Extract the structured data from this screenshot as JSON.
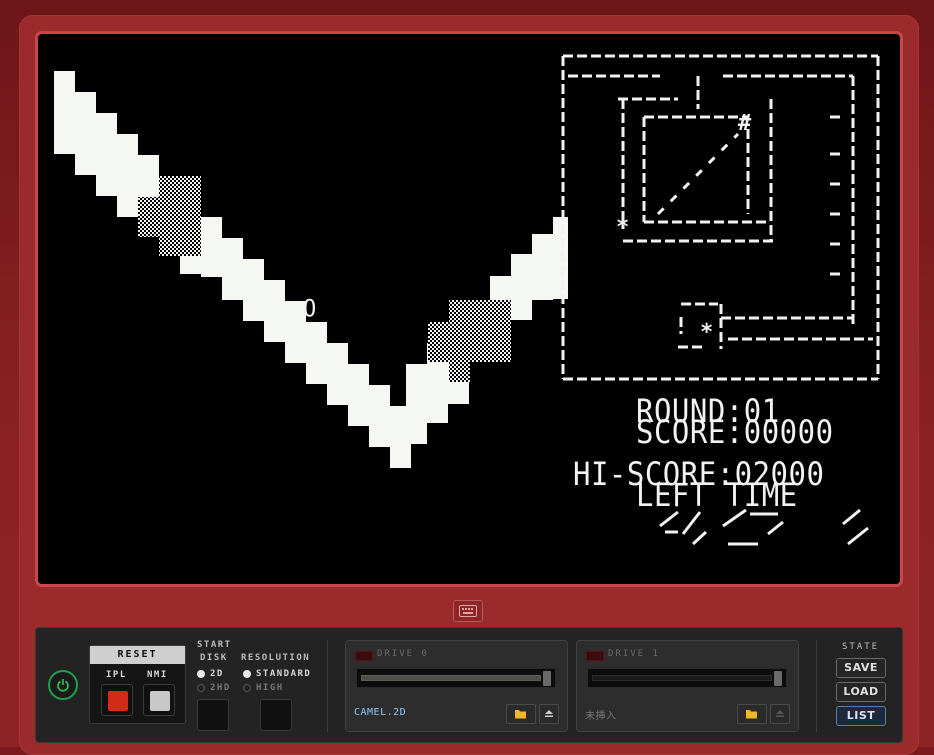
{
  "screen": {
    "round_label": "ROUND:01",
    "score_label": "SCORE:00000",
    "hiscore_label": "HI-SCORE:02000",
    "lefttime_label": "LEFT TIME",
    "player_glyph": "O",
    "colors": {
      "background": "#000000",
      "foreground": "#f2f2f2"
    }
  },
  "keyboard_toggle": {
    "icon": "keyboard-icon"
  },
  "controls": {
    "power_icon": "power-icon",
    "reset": {
      "title": "RESET",
      "ipl_label": "IPL",
      "nmi_label": "NMI"
    },
    "start_disk": {
      "title_line1": "START",
      "title_line2": "DISK",
      "options": [
        "2D",
        "2HD"
      ],
      "selected": "2D"
    },
    "resolution": {
      "title": "RESOLUTION",
      "options": [
        "STANDARD",
        "HIGH"
      ],
      "selected": "STANDARD"
    },
    "drives": [
      {
        "name": "DRIVE 0",
        "file": "CAMEL.2D",
        "file_color": "#8fc8ff"
      },
      {
        "name": "DRIVE 1",
        "file": "未挿入",
        "file_color": "#777777"
      }
    ],
    "state": {
      "title": "STATE",
      "save_label": "SAVE",
      "load_label": "LOAD",
      "list_label": "LIST"
    }
  }
}
